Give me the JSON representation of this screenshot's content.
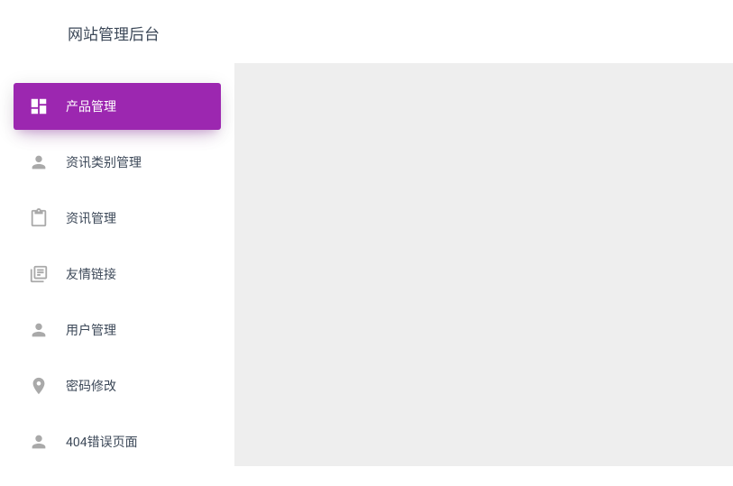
{
  "header": {
    "title": "网站管理后台"
  },
  "sidebar": {
    "items": [
      {
        "label": "产品管理",
        "icon": "dashboard-icon",
        "active": true
      },
      {
        "label": "资讯类别管理",
        "icon": "person-icon",
        "active": false
      },
      {
        "label": "资讯管理",
        "icon": "clipboard-icon",
        "active": false
      },
      {
        "label": "友情链接",
        "icon": "library-icon",
        "active": false
      },
      {
        "label": "用户管理",
        "icon": "person-icon",
        "active": false
      },
      {
        "label": "密码修改",
        "icon": "location-icon",
        "active": false
      },
      {
        "label": "404错误页面",
        "icon": "person-icon",
        "active": false
      }
    ]
  }
}
